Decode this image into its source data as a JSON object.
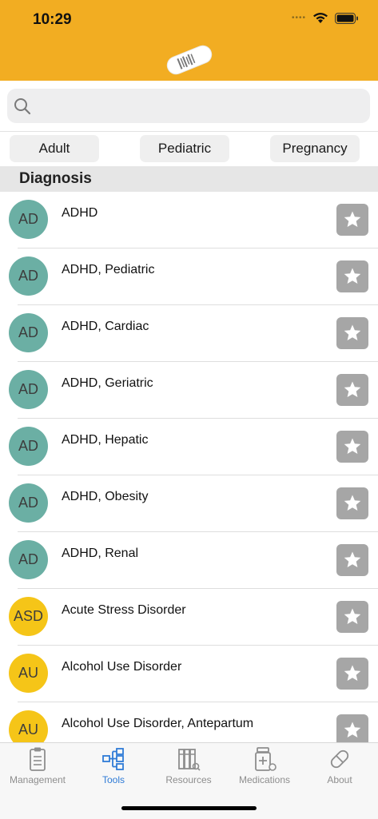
{
  "status": {
    "time": "10:29"
  },
  "colors": {
    "header": "#f2ad22",
    "teal": "#6bafa4",
    "yellow": "#f5c518",
    "tab_active": "#2f7bd6",
    "tab_inactive": "#8e8e8e"
  },
  "search": {
    "placeholder": ""
  },
  "segments": [
    "Adult",
    "Pediatric",
    "Pregnancy"
  ],
  "section": {
    "title": "Diagnosis"
  },
  "items": [
    {
      "abbr": "AD",
      "title": "ADHD",
      "color": "#6bafa4"
    },
    {
      "abbr": "AD",
      "title": "ADHD, Pediatric",
      "color": "#6bafa4"
    },
    {
      "abbr": "AD",
      "title": "ADHD, Cardiac",
      "color": "#6bafa4"
    },
    {
      "abbr": "AD",
      "title": "ADHD, Geriatric",
      "color": "#6bafa4"
    },
    {
      "abbr": "AD",
      "title": "ADHD, Hepatic",
      "color": "#6bafa4"
    },
    {
      "abbr": "AD",
      "title": "ADHD, Obesity",
      "color": "#6bafa4"
    },
    {
      "abbr": "AD",
      "title": "ADHD, Renal",
      "color": "#6bafa4"
    },
    {
      "abbr": "ASD",
      "title": "Acute Stress Disorder",
      "color": "#f5c518"
    },
    {
      "abbr": "AU",
      "title": "Alcohol Use Disorder",
      "color": "#f5c518"
    },
    {
      "abbr": "AU",
      "title": "Alcohol Use Disorder, Antepartum",
      "color": "#f5c518"
    }
  ],
  "tabs": [
    {
      "label": "Management",
      "icon": "clipboard-icon",
      "active": false
    },
    {
      "label": "Tools",
      "icon": "tree-icon",
      "active": true
    },
    {
      "label": "Resources",
      "icon": "books-icon",
      "active": false
    },
    {
      "label": "Medications",
      "icon": "medication-bottle-icon",
      "active": false
    },
    {
      "label": "About",
      "icon": "pill-icon",
      "active": false
    }
  ]
}
